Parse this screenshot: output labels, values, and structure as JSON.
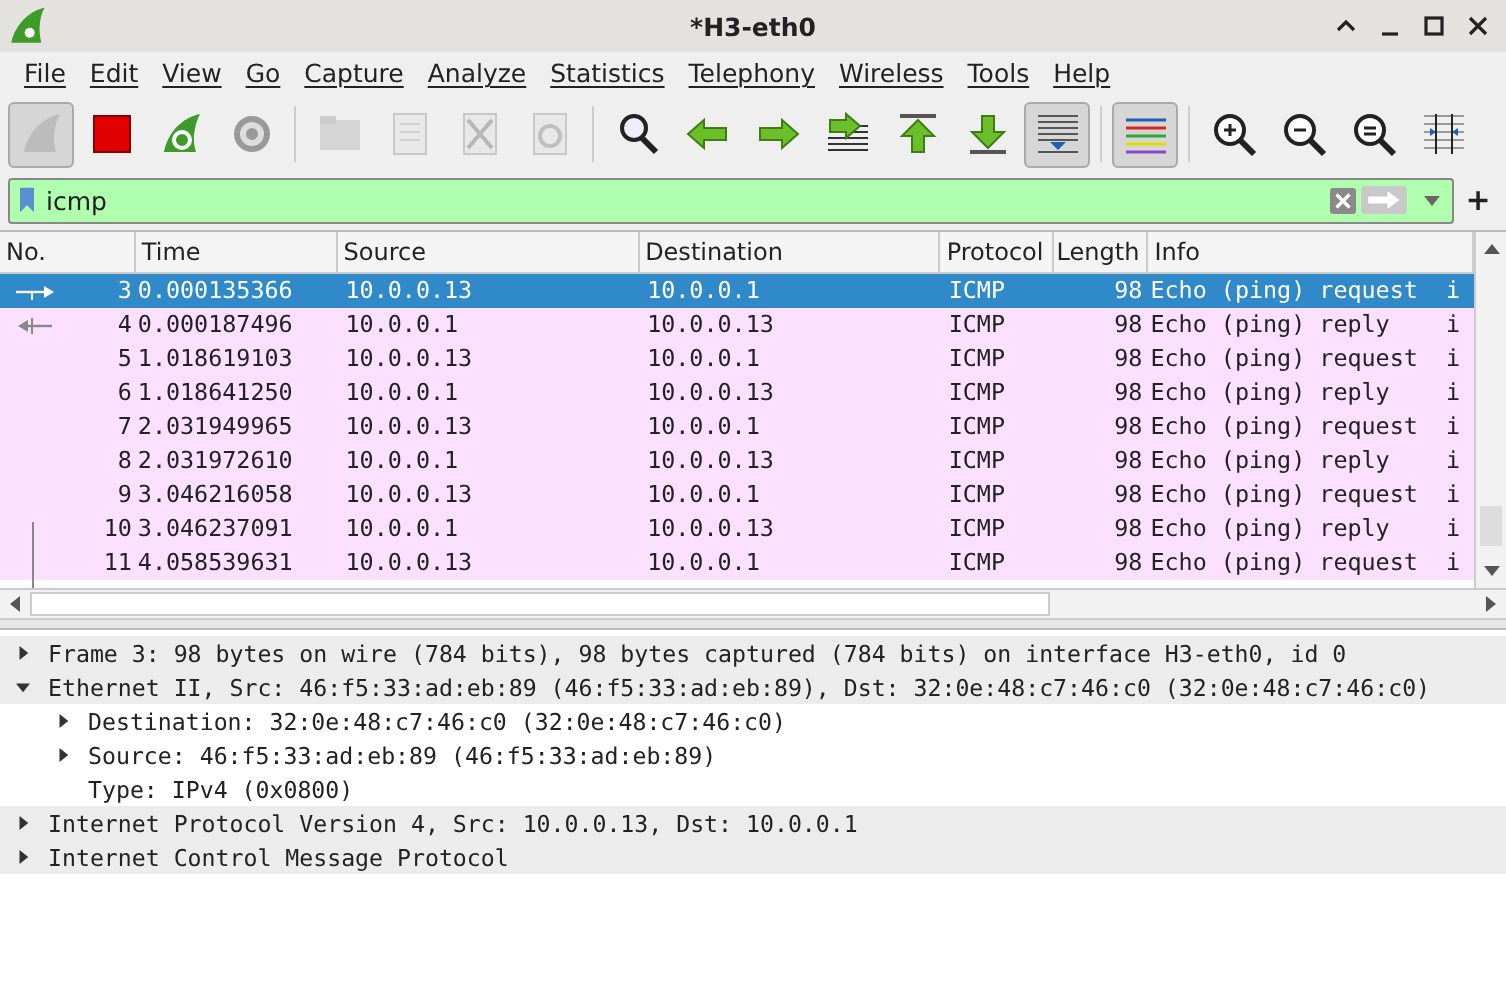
{
  "window": {
    "title": "*H3-eth0"
  },
  "menu": [
    "File",
    "Edit",
    "View",
    "Go",
    "Capture",
    "Analyze",
    "Statistics",
    "Telephony",
    "Wireless",
    "Tools",
    "Help"
  ],
  "toolbar": [
    {
      "kind": "start",
      "pressed": true,
      "disabled": true
    },
    {
      "kind": "stop",
      "pressed": false,
      "disabled": false
    },
    {
      "kind": "restart",
      "pressed": false,
      "disabled": false
    },
    {
      "kind": "options",
      "pressed": false,
      "disabled": false
    },
    {
      "kind": "sep"
    },
    {
      "kind": "open",
      "pressed": false,
      "disabled": true
    },
    {
      "kind": "save",
      "pressed": false,
      "disabled": true
    },
    {
      "kind": "close",
      "pressed": false,
      "disabled": true
    },
    {
      "kind": "reload",
      "pressed": false,
      "disabled": true
    },
    {
      "kind": "sep"
    },
    {
      "kind": "find",
      "pressed": false,
      "disabled": false
    },
    {
      "kind": "back",
      "pressed": false,
      "disabled": false
    },
    {
      "kind": "forward",
      "pressed": false,
      "disabled": false
    },
    {
      "kind": "goto",
      "pressed": false,
      "disabled": false
    },
    {
      "kind": "first",
      "pressed": false,
      "disabled": false
    },
    {
      "kind": "last",
      "pressed": false,
      "disabled": false
    },
    {
      "kind": "autoscroll",
      "pressed": true,
      "disabled": false
    },
    {
      "kind": "sep"
    },
    {
      "kind": "colorize",
      "pressed": true,
      "disabled": false
    },
    {
      "kind": "sep"
    },
    {
      "kind": "zoomin",
      "pressed": false,
      "disabled": false
    },
    {
      "kind": "zoomout",
      "pressed": false,
      "disabled": false
    },
    {
      "kind": "zoomreset",
      "pressed": false,
      "disabled": false
    },
    {
      "kind": "resize",
      "pressed": false,
      "disabled": false
    }
  ],
  "filter": {
    "value": "icmp",
    "valid": true,
    "plus": "+"
  },
  "table": {
    "columns": [
      "No.",
      "Time",
      "Source",
      "Destination",
      "Protocol",
      "Length",
      "Info"
    ],
    "rows": [
      {
        "no": "3",
        "time": "0.000135366",
        "source": "10.0.0.13",
        "destination": "10.0.0.1",
        "protocol": "ICMP",
        "length": "98",
        "info": "Echo (ping) request  i",
        "selected": true,
        "kind": "request"
      },
      {
        "no": "4",
        "time": "0.000187496",
        "source": "10.0.0.1",
        "destination": "10.0.0.13",
        "protocol": "ICMP",
        "length": "98",
        "info": "Echo (ping) reply    i",
        "selected": false,
        "kind": "reply"
      },
      {
        "no": "5",
        "time": "1.018619103",
        "source": "10.0.0.13",
        "destination": "10.0.0.1",
        "protocol": "ICMP",
        "length": "98",
        "info": "Echo (ping) request  i",
        "selected": false
      },
      {
        "no": "6",
        "time": "1.018641250",
        "source": "10.0.0.1",
        "destination": "10.0.0.13",
        "protocol": "ICMP",
        "length": "98",
        "info": "Echo (ping) reply    i",
        "selected": false
      },
      {
        "no": "7",
        "time": "2.031949965",
        "source": "10.0.0.13",
        "destination": "10.0.0.1",
        "protocol": "ICMP",
        "length": "98",
        "info": "Echo (ping) request  i",
        "selected": false
      },
      {
        "no": "8",
        "time": "2.031972610",
        "source": "10.0.0.1",
        "destination": "10.0.0.13",
        "protocol": "ICMP",
        "length": "98",
        "info": "Echo (ping) reply    i",
        "selected": false
      },
      {
        "no": "9",
        "time": "3.046216058",
        "source": "10.0.0.13",
        "destination": "10.0.0.1",
        "protocol": "ICMP",
        "length": "98",
        "info": "Echo (ping) request  i",
        "selected": false
      },
      {
        "no": "10",
        "time": "3.046237091",
        "source": "10.0.0.1",
        "destination": "10.0.0.13",
        "protocol": "ICMP",
        "length": "98",
        "info": "Echo (ping) reply    i",
        "selected": false
      },
      {
        "no": "11",
        "time": "4.058539631",
        "source": "10.0.0.13",
        "destination": "10.0.0.1",
        "protocol": "ICMP",
        "length": "98",
        "info": "Echo (ping) request  i",
        "selected": false
      }
    ]
  },
  "details": [
    {
      "text": "Frame 3: 98 bytes on wire (784 bits), 98 bytes captured (784 bits) on interface H3-eth0, id 0",
      "expanded": false
    },
    {
      "text": "Ethernet II, Src: 46:f5:33:ad:eb:89 (46:f5:33:ad:eb:89), Dst: 32:0e:48:c7:46:c0 (32:0e:48:c7:46:c0)",
      "expanded": true,
      "children": [
        {
          "text": "Destination: 32:0e:48:c7:46:c0 (32:0e:48:c7:46:c0)",
          "expanded": false
        },
        {
          "text": "Source: 46:f5:33:ad:eb:89 (46:f5:33:ad:eb:89)",
          "expanded": false
        },
        {
          "text": "Type: IPv4 (0x0800)"
        }
      ]
    },
    {
      "text": "Internet Protocol Version 4, Src: 10.0.0.13, Dst: 10.0.0.1",
      "expanded": false
    },
    {
      "text": "Internet Control Message Protocol",
      "expanded": false
    }
  ]
}
